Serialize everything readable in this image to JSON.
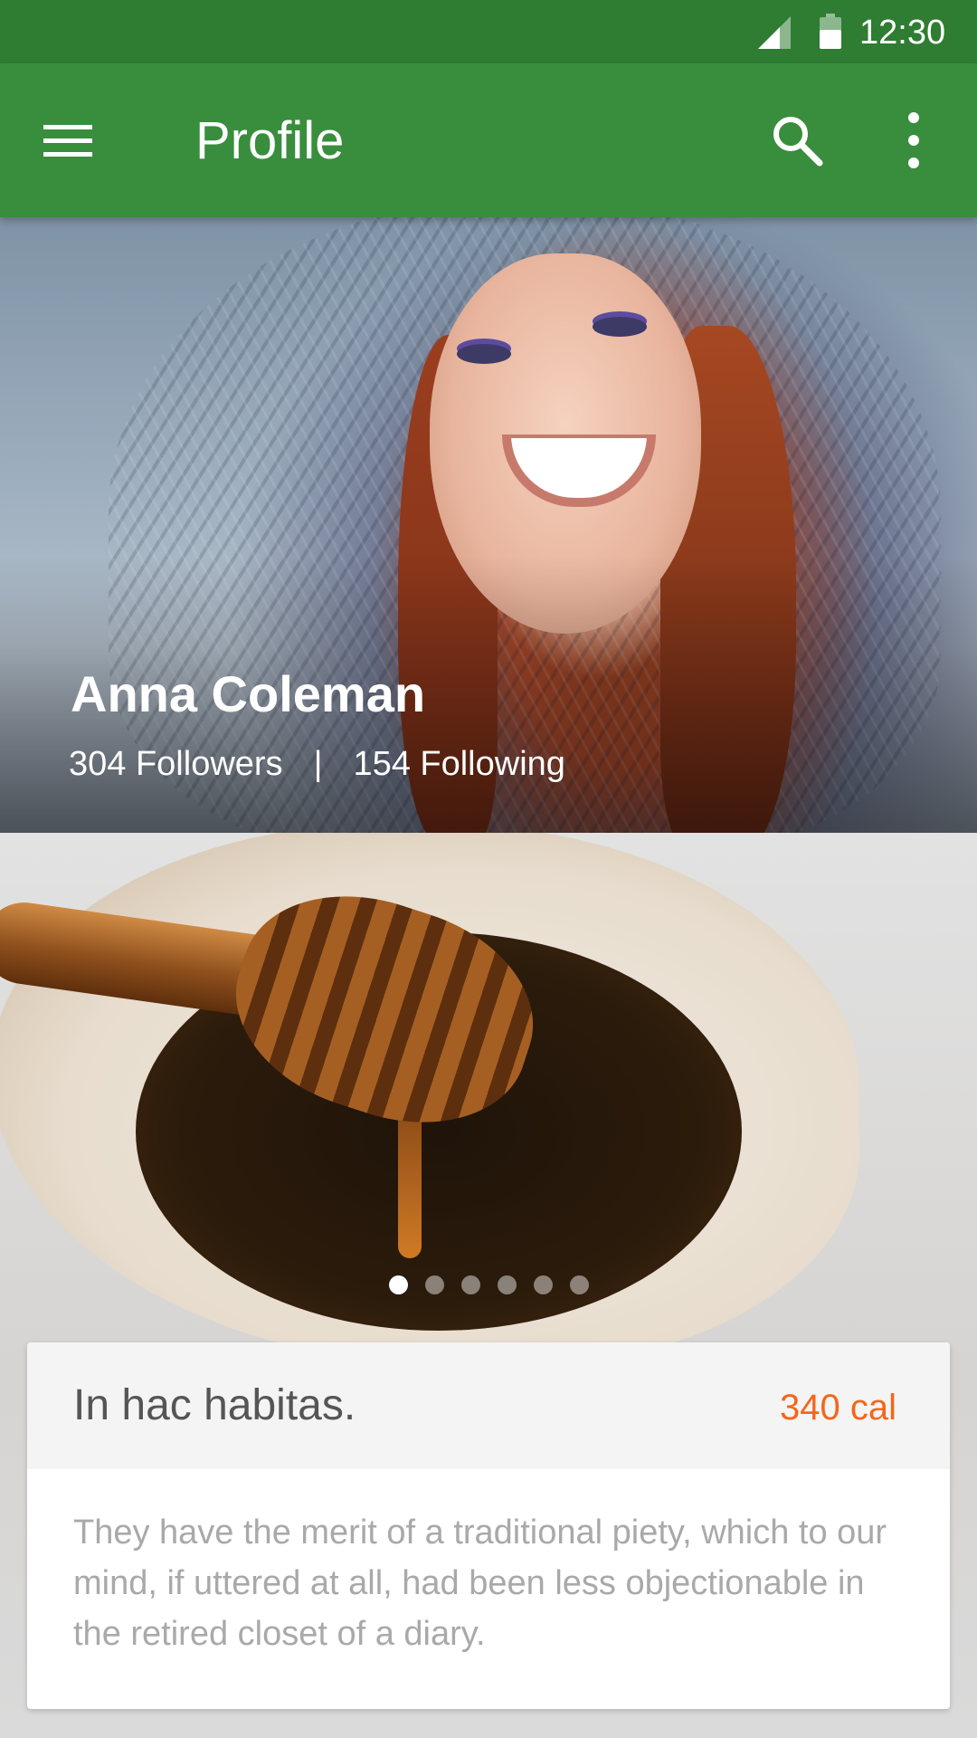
{
  "status_bar": {
    "time": "12:30",
    "icons": [
      "signal-icon",
      "battery-icon"
    ]
  },
  "app_bar": {
    "title": "Profile",
    "icons": [
      "menu-icon",
      "search-icon",
      "more-vert-icon"
    ],
    "color": "#388e3c",
    "status_color": "#2e7d32"
  },
  "profile": {
    "name": "Anna Coleman",
    "followers": "304 Followers",
    "separator": "|",
    "following": "154 Following"
  },
  "slider": {
    "page_count": 6,
    "active_index": 0
  },
  "card": {
    "title": "In hac habitas.",
    "calories": "340 cal",
    "calories_color": "#f4661b",
    "body": "They have the merit of a traditional piety, which to our mind, if uttered at all, had been less objectionable in the retired closet of a diary."
  }
}
